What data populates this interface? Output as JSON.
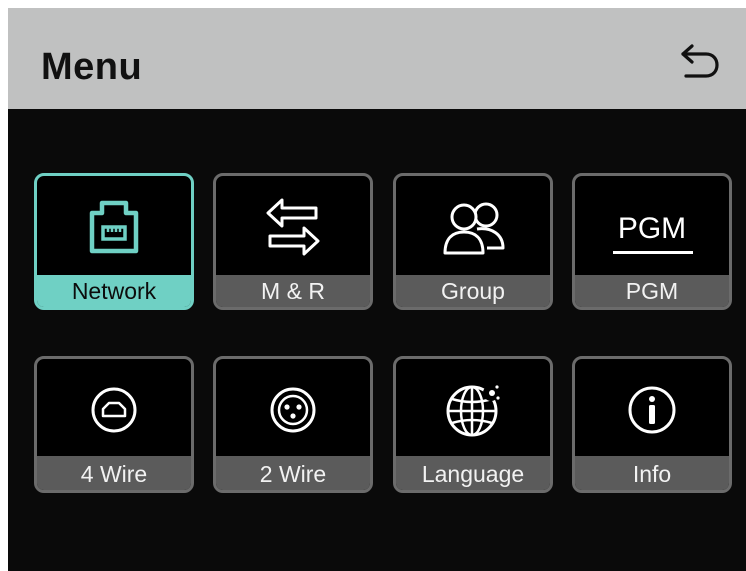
{
  "header": {
    "title": "Menu",
    "back_icon": "back-arrow-icon"
  },
  "menu": {
    "selected": "Network",
    "items": [
      {
        "label": "Network",
        "icon": "ethernet-port-icon",
        "selected": true
      },
      {
        "label": "M & R",
        "icon": "swap-arrows-icon",
        "selected": false
      },
      {
        "label": "Group",
        "icon": "group-users-icon",
        "selected": false
      },
      {
        "label": "PGM",
        "icon": "pgm-text-icon",
        "icon_text": "PGM",
        "selected": false
      },
      {
        "label": "4 Wire",
        "icon": "rj-connector-icon",
        "selected": false
      },
      {
        "label": "2 Wire",
        "icon": "xlr-connector-icon",
        "selected": false
      },
      {
        "label": "Language",
        "icon": "globe-icon",
        "selected": false
      },
      {
        "label": "Info",
        "icon": "info-icon",
        "selected": false
      }
    ]
  },
  "colors": {
    "header_background": "#c0c1c1",
    "screen_background": "#0a0a0a",
    "selected_accent": "#6fd0c4",
    "tile_border": "#6b6b6b",
    "label_background": "#5b5b5b",
    "icon_color": "#ffffff"
  }
}
